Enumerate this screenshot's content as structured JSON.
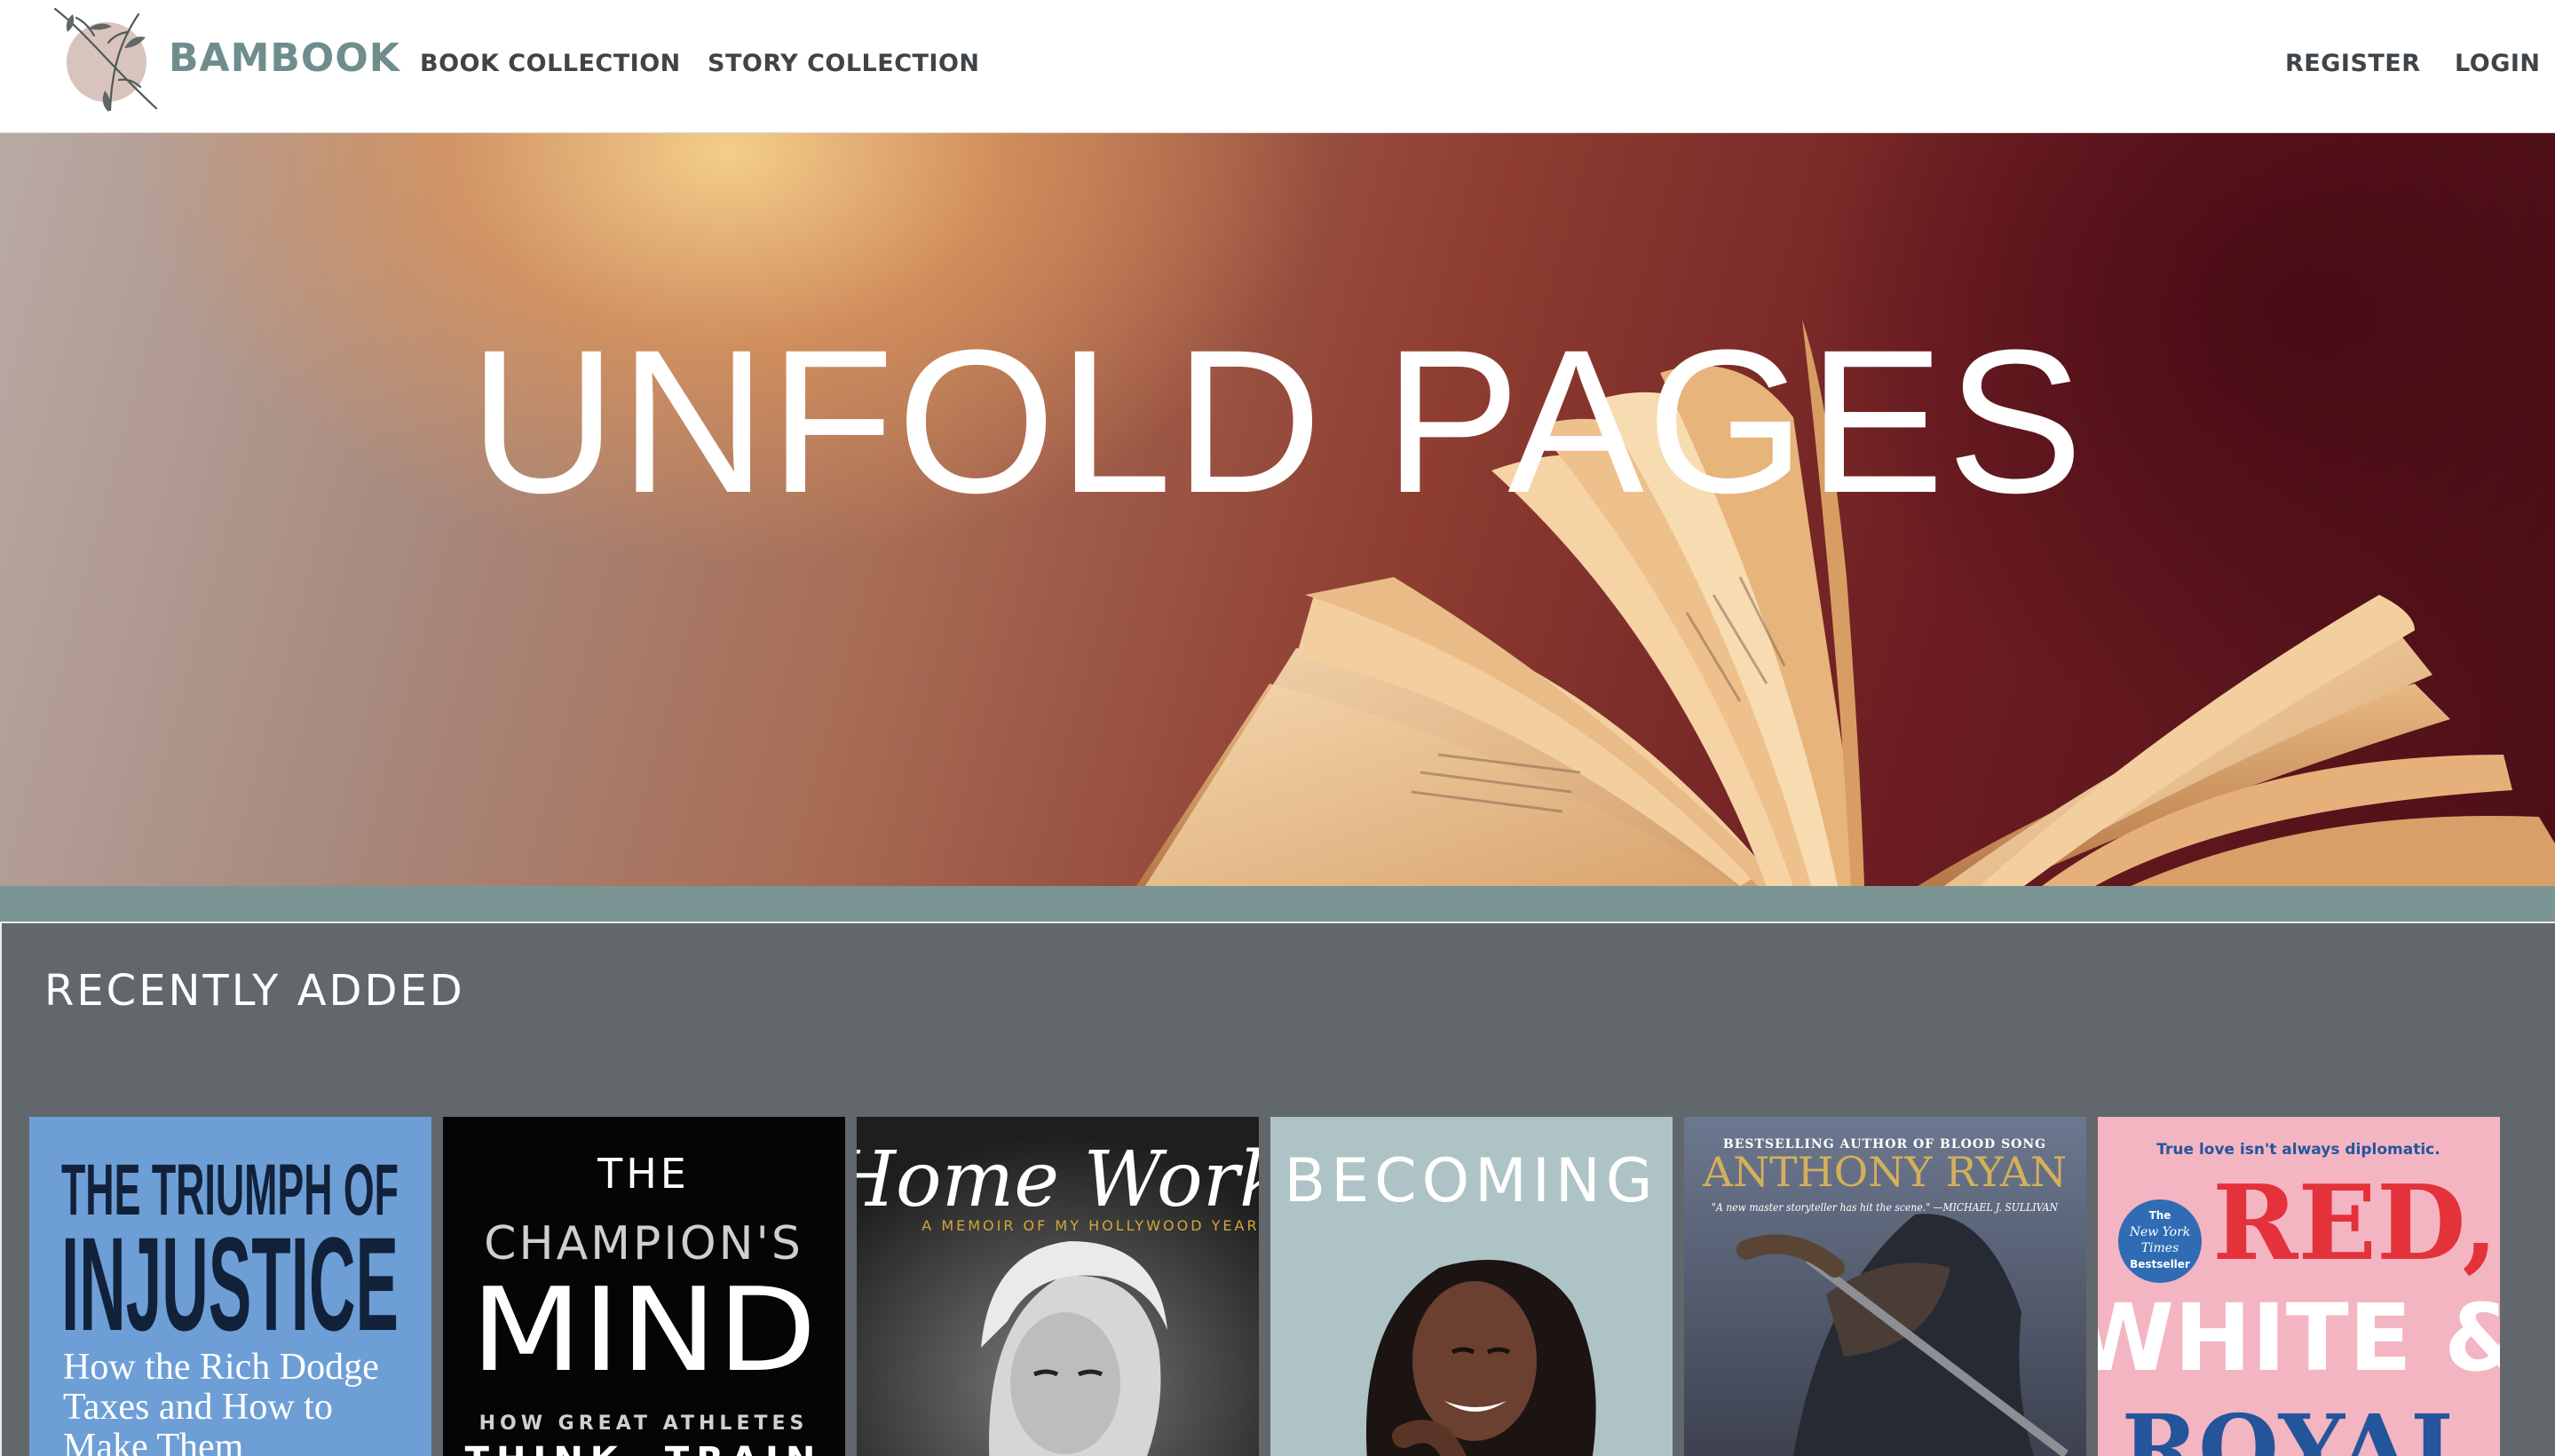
{
  "navbar": {
    "brand": "BAMBOOK",
    "links": [
      "BOOK COLLECTION",
      "STORY COLLECTION"
    ],
    "register": "REGISTER",
    "login": "LOGIN"
  },
  "hero": {
    "title": "UNFOLD PAGES"
  },
  "recent": {
    "title": "RECENTLY ADDED",
    "books": [
      {
        "title_line1": "THE TRIUMPH OF",
        "title_line2": "INJUSTICE",
        "subtitle_line1": "How the Rich Dodge",
        "subtitle_line2": "Taxes and How to",
        "subtitle_line3": "Make Them"
      },
      {
        "title_line1": "THE",
        "title_line2": "CHAMPION'S",
        "title_line3": "MIND",
        "subtitle_line1": "HOW GREAT ATHLETES",
        "subtitle_line2": "THINK, TRAIN"
      },
      {
        "title": "Home Work",
        "subtitle": "A MEMOIR OF MY HOLLYWOOD YEARS"
      },
      {
        "title": "BECOMING"
      },
      {
        "tagline": "BESTSELLING AUTHOR OF BLOOD SONG",
        "author": "ANTHONY RYAN",
        "quote": "\"A new master storyteller has hit the scene.\" —MICHAEL J. SULLIVAN"
      },
      {
        "tagline": "True love isn't always diplomatic.",
        "badge_line1": "The",
        "badge_line2": "New York",
        "badge_line3": "Times",
        "badge_line4": "Bestseller",
        "title_line1": "RED,",
        "title_line2": "WHITE &",
        "title_line3": "ROYAL"
      }
    ]
  },
  "colors": {
    "brand": "#6e8d8c",
    "nav_text": "#3e4448",
    "strip": "#7a9593",
    "section_bg": "#61676a"
  }
}
